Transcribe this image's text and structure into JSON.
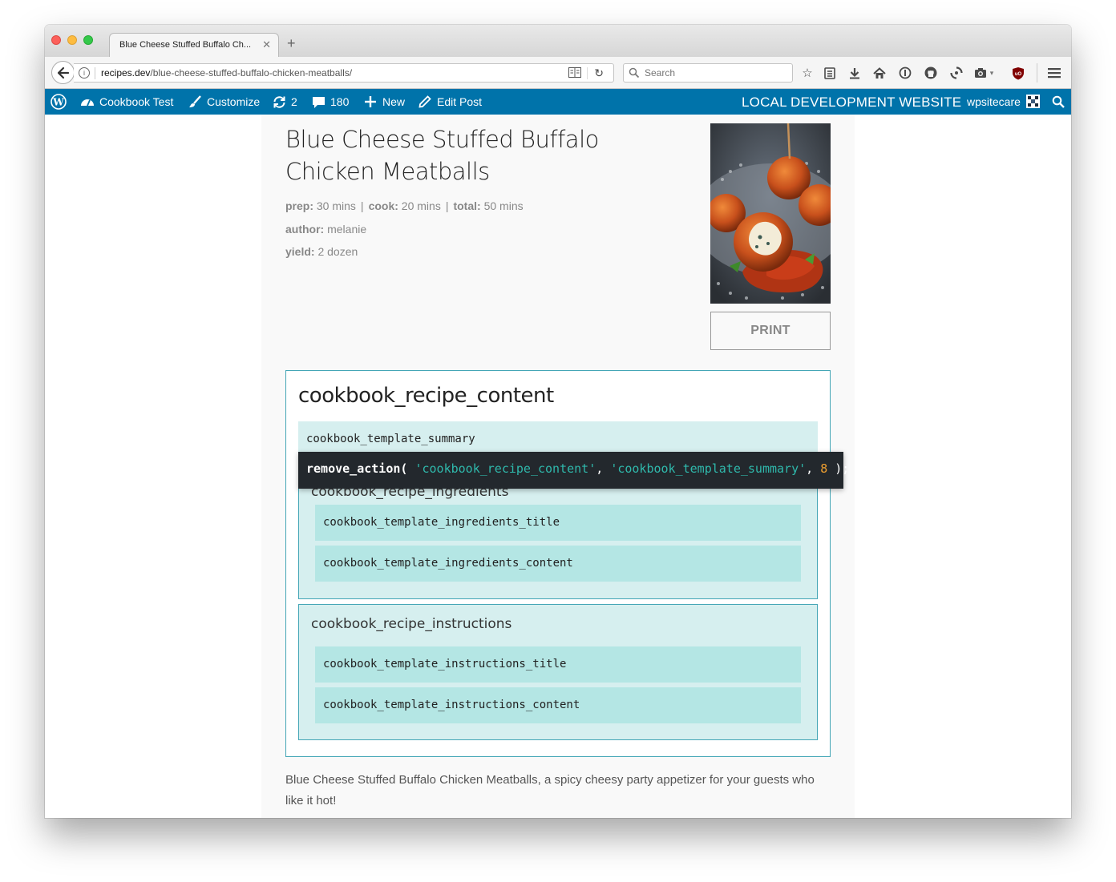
{
  "browser": {
    "tab_title": "Blue Cheese Stuffed Buffalo Ch...",
    "url_host": "recipes.dev",
    "url_path": "/blue-cheese-stuffed-buffalo-chicken-meatballs/",
    "search_placeholder": "Search"
  },
  "adminbar": {
    "site_name": "Cookbook Test",
    "customize": "Customize",
    "updates_count": "2",
    "comments_count": "180",
    "new_label": "New",
    "edit_label": "Edit Post",
    "environment_label": "LOCAL DEVELOPMENT WEBSITE",
    "user": "wpsitecare"
  },
  "recipe": {
    "title": "Blue Cheese Stuffed Buffalo Chicken Meatballs",
    "prep_label": "prep:",
    "prep_value": "30 mins",
    "cook_label": "cook:",
    "cook_value": "20 mins",
    "total_label": "total:",
    "total_value": "50 mins",
    "author_label": "author:",
    "author_value": "melanie",
    "yield_label": "yield:",
    "yield_value": "2 dozen",
    "print_label": "PRINT",
    "intro": "Blue Cheese Stuffed Buffalo Chicken Meatballs, a spicy cheesy party appetizer for your guests who like it hot!"
  },
  "hooks": {
    "outer": "cookbook_recipe_content",
    "summary": "cookbook_template_summary",
    "ingredients_group": "cookbook_recipe_ingredients",
    "ingredients_title": "cookbook_template_ingredients_title",
    "ingredients_content": "cookbook_template_ingredients_content",
    "instructions_group": "cookbook_recipe_instructions",
    "instructions_title": "cookbook_template_instructions_title",
    "instructions_content": "cookbook_template_instructions_content"
  },
  "code": {
    "function": "remove_action(",
    "arg1": "'cookbook_recipe_content'",
    "comma1": ", ",
    "arg2": "'cookbook_template_summary'",
    "comma2": ", ",
    "priority": "8",
    "close": " );"
  },
  "colors": {
    "admin_bar": "#0073aa",
    "hook_border": "#44a6b6",
    "hook_light": "#d6efef",
    "hook_dark": "#b4e6e4",
    "code_bg": "#23282d",
    "code_string": "#2fb9ac",
    "code_number": "#f0a030"
  }
}
